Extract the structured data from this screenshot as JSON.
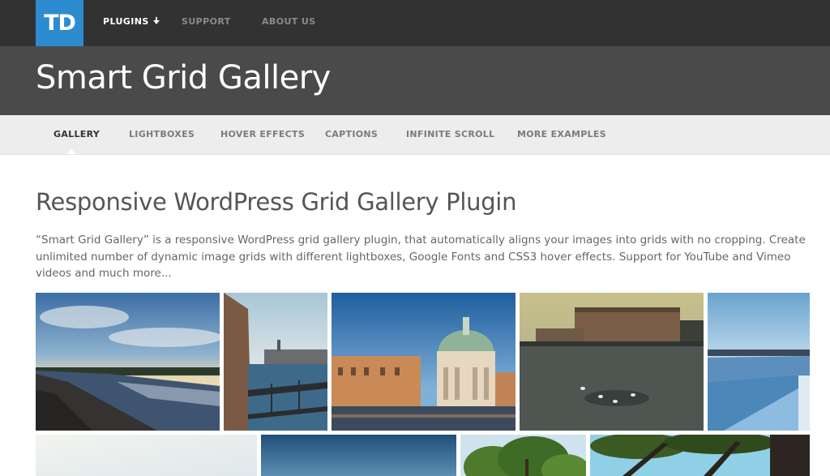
{
  "logo": {
    "text": "TD"
  },
  "topnav": {
    "items": [
      {
        "label": "PLUGINS",
        "active": true
      },
      {
        "label": "SUPPORT",
        "active": false
      },
      {
        "label": "ABOUT US",
        "active": false
      }
    ]
  },
  "header": {
    "title": "Smart Grid Gallery"
  },
  "subnav": {
    "items": [
      {
        "label": "GALLERY",
        "active": true
      },
      {
        "label": "LIGHTBOXES",
        "active": false
      },
      {
        "label": "HOVER EFFECTS",
        "active": false
      },
      {
        "label": "CAPTIONS",
        "active": false
      },
      {
        "label": "INFINITE SCROLL",
        "active": false
      },
      {
        "label": "MORE EXAMPLES",
        "active": false
      }
    ]
  },
  "main": {
    "heading": "Responsive WordPress Grid Gallery Plugin",
    "intro": "“Smart Grid Gallery” is a responsive WordPress grid gallery plugin, that automatically aligns your images into grids with no cropping. Create unlimited number of dynamic image grids with different lightboxes, Google Fonts and CSS3 hover effects. Support for YouTube and Vimeo videos and much more..."
  },
  "colors": {
    "topbar": "#323232",
    "titleband": "#4a4a4a",
    "subnav": "#ededed",
    "logo": "#2d8bd0"
  },
  "gallery": {
    "images": [
      {
        "name": "gallery-image-river-sunset"
      },
      {
        "name": "gallery-image-canal-railing"
      },
      {
        "name": "gallery-image-venice-church"
      },
      {
        "name": "gallery-image-palace-waterfront"
      },
      {
        "name": "gallery-image-snowy-riverbank"
      },
      {
        "name": "gallery-image-hazy-sky"
      },
      {
        "name": "gallery-image-blue-sky"
      },
      {
        "name": "gallery-image-tree-top"
      },
      {
        "name": "gallery-image-tree-branches"
      }
    ]
  }
}
